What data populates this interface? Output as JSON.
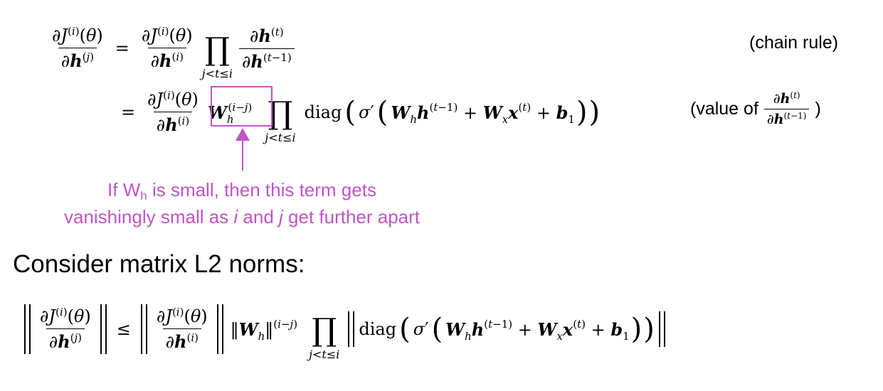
{
  "equations": {
    "line1_tag": "(chain rule)",
    "line2_tag_prefix": "(value of",
    "line2_tag_suffix": ")"
  },
  "annotation": {
    "line1_prefix": "If W",
    "line1_sub": "h",
    "line1_suffix": " is small, then this term gets",
    "line2_a": "vanishingly small as ",
    "line2_i": "i",
    "line2_b": " and ",
    "line2_j": "j",
    "line2_c": " get further apart",
    "color": "#c055c5"
  },
  "section": {
    "heading": "Consider matrix L2 norms:"
  }
}
